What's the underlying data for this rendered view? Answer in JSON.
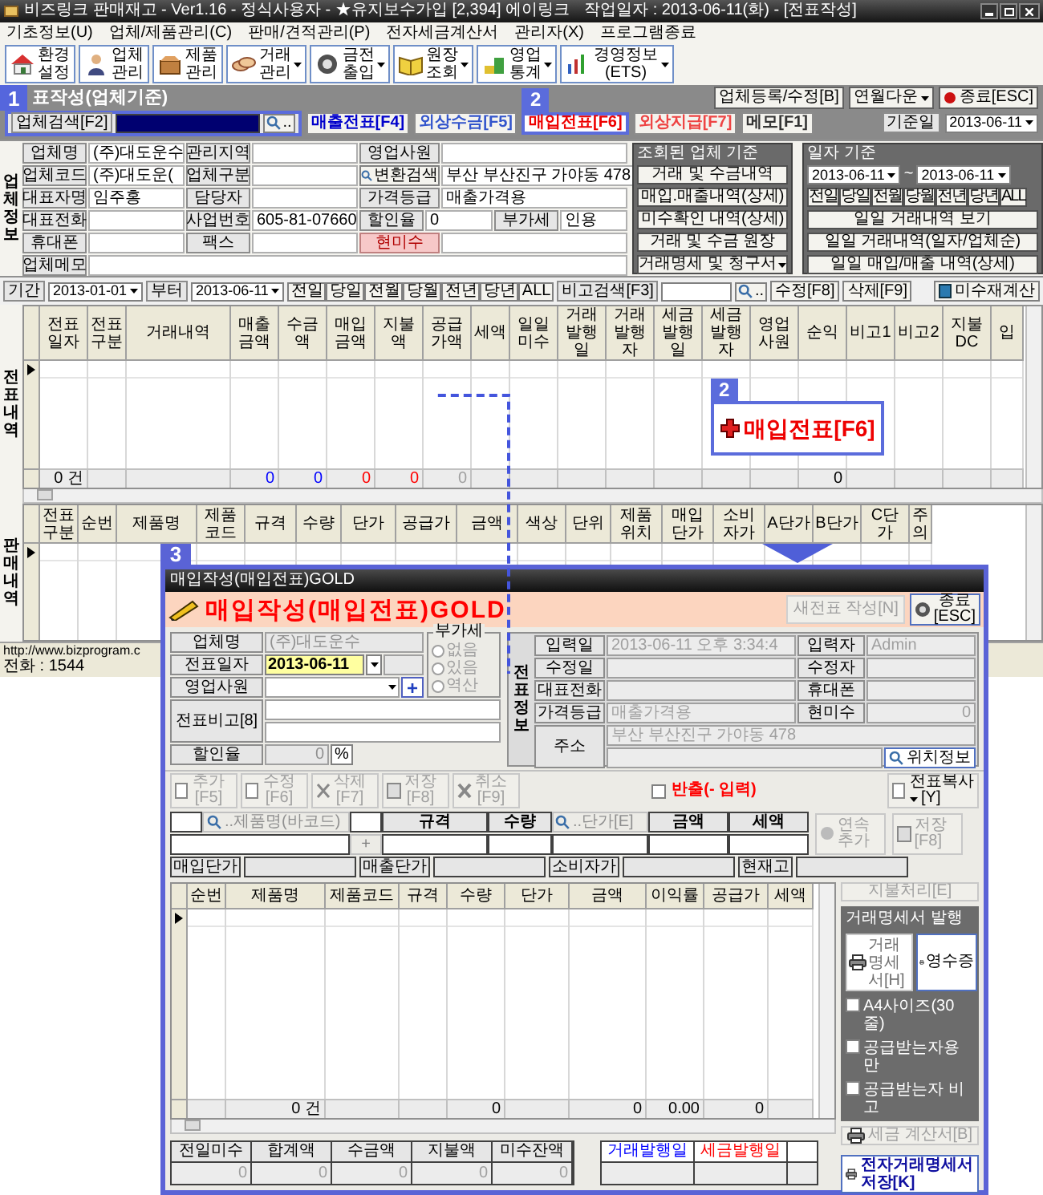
{
  "window": {
    "title": "비즈링크 판매재고 - Ver1.16 - 정식사용자 - ★유지보수가입 [2,394] 에이링크",
    "work_date": "작업일자 : 2013-06-11(화) - [전표작성]"
  },
  "menu": [
    "기초정보(U)",
    "업체/제품관리(C)",
    "판매/견적관리(P)",
    "전자세금계산서",
    "관리자(X)",
    "프로그램종료"
  ],
  "toolbar": [
    {
      "label": "환경설정",
      "dropdown": false
    },
    {
      "label": "업체관리",
      "dropdown": false
    },
    {
      "label": "제품관리",
      "dropdown": false
    },
    {
      "label": "거래관리",
      "dropdown": true
    },
    {
      "label": "금전출입",
      "dropdown": true
    },
    {
      "label": "원장조회",
      "dropdown": true
    },
    {
      "label": "영업통계",
      "dropdown": true
    },
    {
      "label": "경영정보(ETS)",
      "dropdown": true
    }
  ],
  "section": {
    "badge": "1",
    "title": "표작성(업체기준)",
    "buttons": [
      {
        "label": "업체등록/수정[B]",
        "dropdown": false
      },
      {
        "label": "연월다운",
        "dropdown": true
      },
      {
        "label": "종료[ESC]",
        "dropdown": false
      }
    ]
  },
  "search": {
    "label": "업체검색[F2]",
    "more": "..",
    "badge": "2",
    "tabs": [
      {
        "label": "매출전표[F4]",
        "selected": false,
        "color": "#0000cc"
      },
      {
        "label": "외상수금[F5]",
        "selected": false,
        "color": "#3355cc"
      },
      {
        "label": "매입전표[F6]",
        "selected": true,
        "color": "#ee0000"
      },
      {
        "label": "외상지급[F7]",
        "selected": false,
        "color": "#ee4444"
      },
      {
        "label": "메모[F1]",
        "selected": false,
        "color": "#333333"
      }
    ],
    "date_label": "기준일",
    "date": "2013-06-11"
  },
  "company": {
    "side_label": "업체정보",
    "rows": [
      [
        {
          "kind": "label",
          "text": "업체명"
        },
        {
          "kind": "value",
          "text": "(주)대도운수"
        },
        {
          "kind": "label",
          "text": "관리지역"
        },
        {
          "kind": "value"
        },
        {
          "kind": "label",
          "text": "영업사원"
        },
        {
          "kind": "value"
        }
      ],
      [
        {
          "kind": "label",
          "text": "업체코드"
        },
        {
          "kind": "value",
          "text": "(주)대도운("
        },
        {
          "kind": "label",
          "text": "업체구분"
        },
        {
          "kind": "value"
        },
        {
          "kind": "button",
          "text": "변환검색"
        },
        {
          "kind": "value",
          "text": "부산 부산진구 가야동 478"
        }
      ],
      [
        {
          "kind": "label",
          "text": "대표자명"
        },
        {
          "kind": "value",
          "text": "임주홍"
        },
        {
          "kind": "label",
          "text": "담당자"
        },
        {
          "kind": "value"
        },
        {
          "kind": "label",
          "text": "가격등급"
        },
        {
          "kind": "value",
          "text": "매출가격용"
        }
      ],
      [
        {
          "kind": "label",
          "text": "대표전화"
        },
        {
          "kind": "value"
        },
        {
          "kind": "label",
          "text": "사업번호"
        },
        {
          "kind": "value",
          "text": "605-81-07660"
        },
        {
          "kind": "label",
          "text": "할인율"
        },
        {
          "kind": "value",
          "text": "0"
        },
        {
          "kind": "label",
          "text": "부가세"
        },
        {
          "kind": "value",
          "text": "인용"
        }
      ],
      [
        {
          "kind": "label",
          "text": "휴대폰"
        },
        {
          "kind": "value"
        },
        {
          "kind": "label",
          "text": "팩스"
        },
        {
          "kind": "value"
        },
        {
          "kind": "alert",
          "text": "현미수"
        },
        {
          "kind": "value"
        }
      ],
      [
        {
          "kind": "label",
          "text": "업체메모"
        },
        {
          "kind": "value"
        }
      ]
    ]
  },
  "lookup": {
    "title": "조회된 업체 기준",
    "buttons": [
      {
        "label": "거래 및 수금내역",
        "dropdown": false
      },
      {
        "label": "매입.매출내역(상세)",
        "dropdown": false
      },
      {
        "label": "미수확인 내역(상세)",
        "dropdown": false
      },
      {
        "label": "거래 및 수금 원장",
        "dropdown": false
      },
      {
        "label": "거래명세 및 청구서",
        "dropdown": true
      }
    ]
  },
  "date_filter": {
    "title": "일자 기준",
    "from": "2013-06-11",
    "separator": "~",
    "to": "2013-06-11",
    "periods": [
      "전일",
      "당일",
      "전월",
      "당월",
      "전년",
      "당년",
      "ALL"
    ],
    "buttons": [
      "일일 거래내역 보기",
      "일일 거래내역(일자/업체순)",
      "일일 매입/매출 내역(상세)"
    ]
  },
  "filter": {
    "period_label": "기간",
    "from": "2013-01-01",
    "from_label": "부터",
    "to": "2013-06-11",
    "periods": [
      "전일",
      "당일",
      "전월",
      "당월",
      "전년",
      "당년",
      "ALL"
    ],
    "memo_label": "비고검색[F3]",
    "more": "..",
    "edit": "수정[F8]",
    "delete": "삭제[F9]",
    "recalc": "미수재계산"
  },
  "vouchers": {
    "side_label": "전표내역",
    "columns": [
      {
        "label": "전표일자",
        "total": "0 건"
      },
      {
        "label": "전표구분"
      },
      {
        "label": "거래내역"
      },
      {
        "label": "매출금액",
        "total": "0",
        "color": "#0000ff"
      },
      {
        "label": "수금액",
        "total": "0",
        "color": "#0000ff"
      },
      {
        "label": "매입금액",
        "total": "0",
        "color": "#ff0000"
      },
      {
        "label": "지불액",
        "total": "0",
        "color": "#ff0000"
      },
      {
        "label": "공급가액",
        "total": "0",
        "color": "#a0a0a0"
      },
      {
        "label": "세액"
      },
      {
        "label": "일일미수"
      },
      {
        "label": "거래발행일"
      },
      {
        "label": "거래발행자"
      },
      {
        "label": "세금발행일"
      },
      {
        "label": "세금발행자"
      },
      {
        "label": "영업사원"
      },
      {
        "label": "순익",
        "total": "0",
        "color": "#000000"
      },
      {
        "label": "비고1"
      },
      {
        "label": "비고2"
      },
      {
        "label": "지불DC"
      },
      {
        "label": "입"
      }
    ]
  },
  "callout": {
    "badge": "2",
    "label": "매입전표[F6]"
  },
  "sales": {
    "side_label": "판매내역",
    "columns": [
      {
        "label": "전표구분"
      },
      {
        "label": "순번"
      },
      {
        "label": "제품명"
      },
      {
        "label": "제품코드"
      },
      {
        "label": "규격"
      },
      {
        "label": "수량"
      },
      {
        "label": "단가"
      },
      {
        "label": "공급가"
      },
      {
        "label": "금액"
      },
      {
        "label": "색상"
      },
      {
        "label": "단위"
      },
      {
        "label": "제품위치"
      },
      {
        "label": "매입단가"
      },
      {
        "label": "소비자가"
      },
      {
        "label": "A단가"
      },
      {
        "label": "B단가"
      },
      {
        "label": "C단가"
      },
      {
        "label": "주의"
      }
    ]
  },
  "status_bar": {
    "url": "http://www.bizprogram.c",
    "phone": "전화 : 1544"
  },
  "dialog": {
    "badge": "3",
    "title": "매입작성(매입전표)GOLD",
    "heading": "매입작성(매입전표)GOLD",
    "new_button": {
      "label": "새전표 작성[N]",
      "disabled": true
    },
    "close_button": {
      "label": "종료",
      "shortcut": "[ESC]"
    },
    "company_label": "업체명",
    "company": "(주)대도운수",
    "date_label": "전표일자",
    "date": "2013-06-11",
    "sales_rep_label": "영업사원",
    "add": "+",
    "memo_label": "전표비고[8]",
    "discount_label": "할인율",
    "discount": "0",
    "percent": "%",
    "vat": {
      "title": "부가세",
      "options": [
        {
          "label": "없음",
          "selected": false
        },
        {
          "label": "있음",
          "selected": false
        },
        {
          "label": "역산",
          "selected": false
        }
      ]
    },
    "info": {
      "side_label": "전표정보",
      "rows": [
        [
          {
            "kind": "label",
            "text": "입력일"
          },
          {
            "kind": "value",
            "text": "2013-06-11 오후 3:34:4"
          },
          {
            "kind": "label",
            "text": "입력자"
          },
          {
            "kind": "value",
            "text": "Admin"
          }
        ],
        [
          {
            "kind": "label",
            "text": "수정일"
          },
          {
            "kind": "value"
          },
          {
            "kind": "label",
            "text": "수정자"
          },
          {
            "kind": "value"
          }
        ],
        [
          {
            "kind": "label",
            "text": "대표전화"
          },
          {
            "kind": "value"
          },
          {
            "kind": "label",
            "text": "휴대폰"
          },
          {
            "kind": "value"
          }
        ],
        [
          {
            "kind": "label",
            "text": "가격등급"
          },
          {
            "kind": "value",
            "text": "매출가격용"
          },
          {
            "kind": "label",
            "text": "현미수"
          },
          {
            "kind": "number",
            "text": "0"
          }
        ]
      ],
      "address_label": "주소",
      "address": "부산 부산진구 가야동 478",
      "locate": "위치정보"
    },
    "actions": [
      {
        "label": "추가",
        "shortcut": "[F5]",
        "disabled": true
      },
      {
        "label": "수정",
        "shortcut": "[F6]",
        "disabled": true
      },
      {
        "label": "삭제",
        "shortcut": "[F7]",
        "disabled": true
      },
      {
        "label": "저장",
        "shortcut": "[F8]",
        "disabled": true
      },
      {
        "label": "취소",
        "shortcut": "[F9]",
        "disabled": true
      }
    ],
    "return": {
      "label": "반출(- 입력)",
      "checked": false
    },
    "copy": {
      "label": "전표복사",
      "shortcut": "[Y]"
    },
    "entry": {
      "product_search": "..제품명(바코드)",
      "price_search": "..단가[E]",
      "headers": [
        "규격",
        "수량",
        "금액",
        "세액"
      ],
      "plus": "+",
      "buttons": [
        {
          "label": "연속추가",
          "disabled": true
        },
        {
          "label": "저장[F8]",
          "disabled": true
        }
      ]
    },
    "prices": [
      "매입단가",
      "매출단가",
      "소비자가",
      "현재고"
    ],
    "grid": {
      "columns": [
        {
          "label": "순번"
        },
        {
          "label": "제품명",
          "total": "0 건"
        },
        {
          "label": "제품코드"
        },
        {
          "label": "규격"
        },
        {
          "label": "수량",
          "total": "0"
        },
        {
          "label": "단가"
        },
        {
          "label": "금액",
          "total": "0"
        },
        {
          "label": "이익률",
          "total": "0.00"
        },
        {
          "label": "공급가",
          "total": "0"
        },
        {
          "label": "세액"
        }
      ]
    },
    "side": {
      "pay": {
        "label": "지불처리[E]",
        "disabled": true
      },
      "group_title": "거래명세서 발행",
      "statement": {
        "label": "거래명세서[H]",
        "disabled": true
      },
      "receipt": {
        "label": "영수증",
        "disabled": false
      },
      "options": [
        {
          "label": "A4사이즈(30줄)",
          "checked": false
        },
        {
          "label": "공급받는자용만",
          "checked": false
        },
        {
          "label": "공급받는자 비고",
          "checked": false
        }
      ],
      "tax_invoice": {
        "label": "세금 계산서[B]",
        "disabled": true
      },
      "e_statement": "전자거래명세서 저장[K]"
    },
    "summary": {
      "fields": [
        {
          "label": "전일미수",
          "value": "0"
        },
        {
          "label": "합계액",
          "value": "0"
        },
        {
          "label": "수금액",
          "value": "0"
        },
        {
          "label": "지불액",
          "value": "0"
        },
        {
          "label": "미수잔액",
          "value": "0"
        }
      ],
      "issue": [
        {
          "label": "거래발행일",
          "color": "#0000ff"
        },
        {
          "label": "세금발행일",
          "color": "#ff0000"
        }
      ]
    }
  }
}
